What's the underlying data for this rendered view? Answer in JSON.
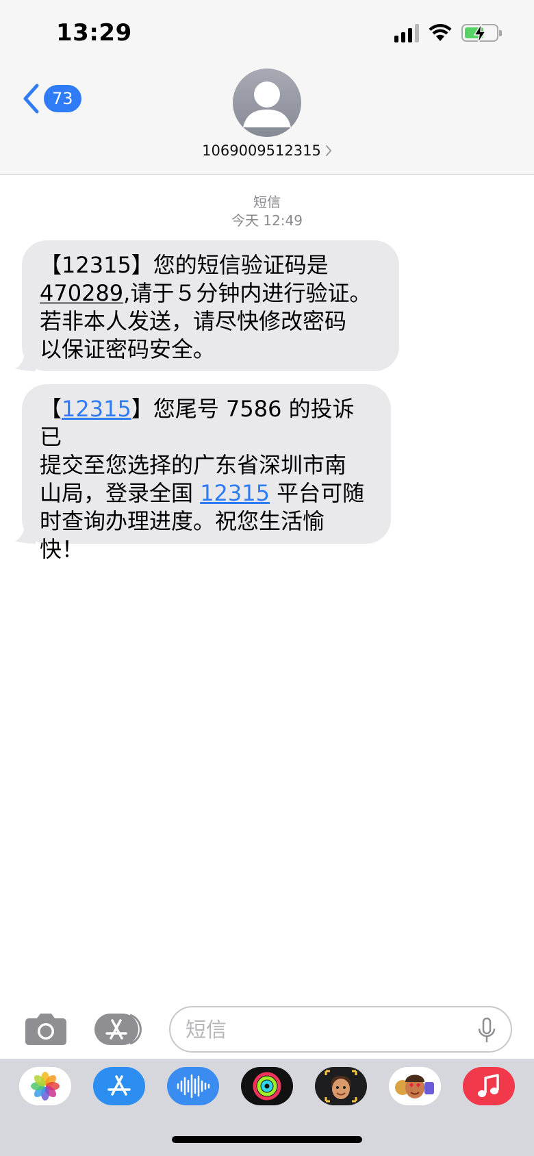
{
  "status_bar": {
    "time": "13:29"
  },
  "header": {
    "back_badge": "73",
    "contact_number": "1069009512315"
  },
  "conversation": {
    "service_label": "短信",
    "timestamp": "今天 12:49",
    "messages": [
      {
        "line1_prefix": "【12315】您的短信验证码是",
        "code": "470289",
        "line2_suffix": ",请于５分钟内进行验证。",
        "line3": "若非本人发送，请尽快修改密码",
        "line4": "以保证密码安全。"
      },
      {
        "open_bracket": "【",
        "link_number": "12315",
        "line1_suffix": "】您尾号 7586 的投诉已",
        "line2": "提交至您选择的广东省深圳市南",
        "line3_prefix": "山局，登录全国 ",
        "line3_link": "12315",
        "line3_suffix": " 平台可随",
        "line4": "时查询办理进度。祝您生活愉",
        "line5": "快！"
      }
    ]
  },
  "input_bar": {
    "placeholder": "短信"
  },
  "app_drawer": {
    "apps": [
      "photos-app",
      "app-store-app",
      "audio-message-app",
      "activity-app",
      "memoji-app",
      "animoji-stickers-app",
      "music-app"
    ]
  },
  "colors": {
    "accent": "#2f7cf6",
    "bubble": "#e9e9eb",
    "header_bg": "#f6f6f6",
    "drawer_bg": "#d6d7dc",
    "music_red": "#f2384b"
  }
}
